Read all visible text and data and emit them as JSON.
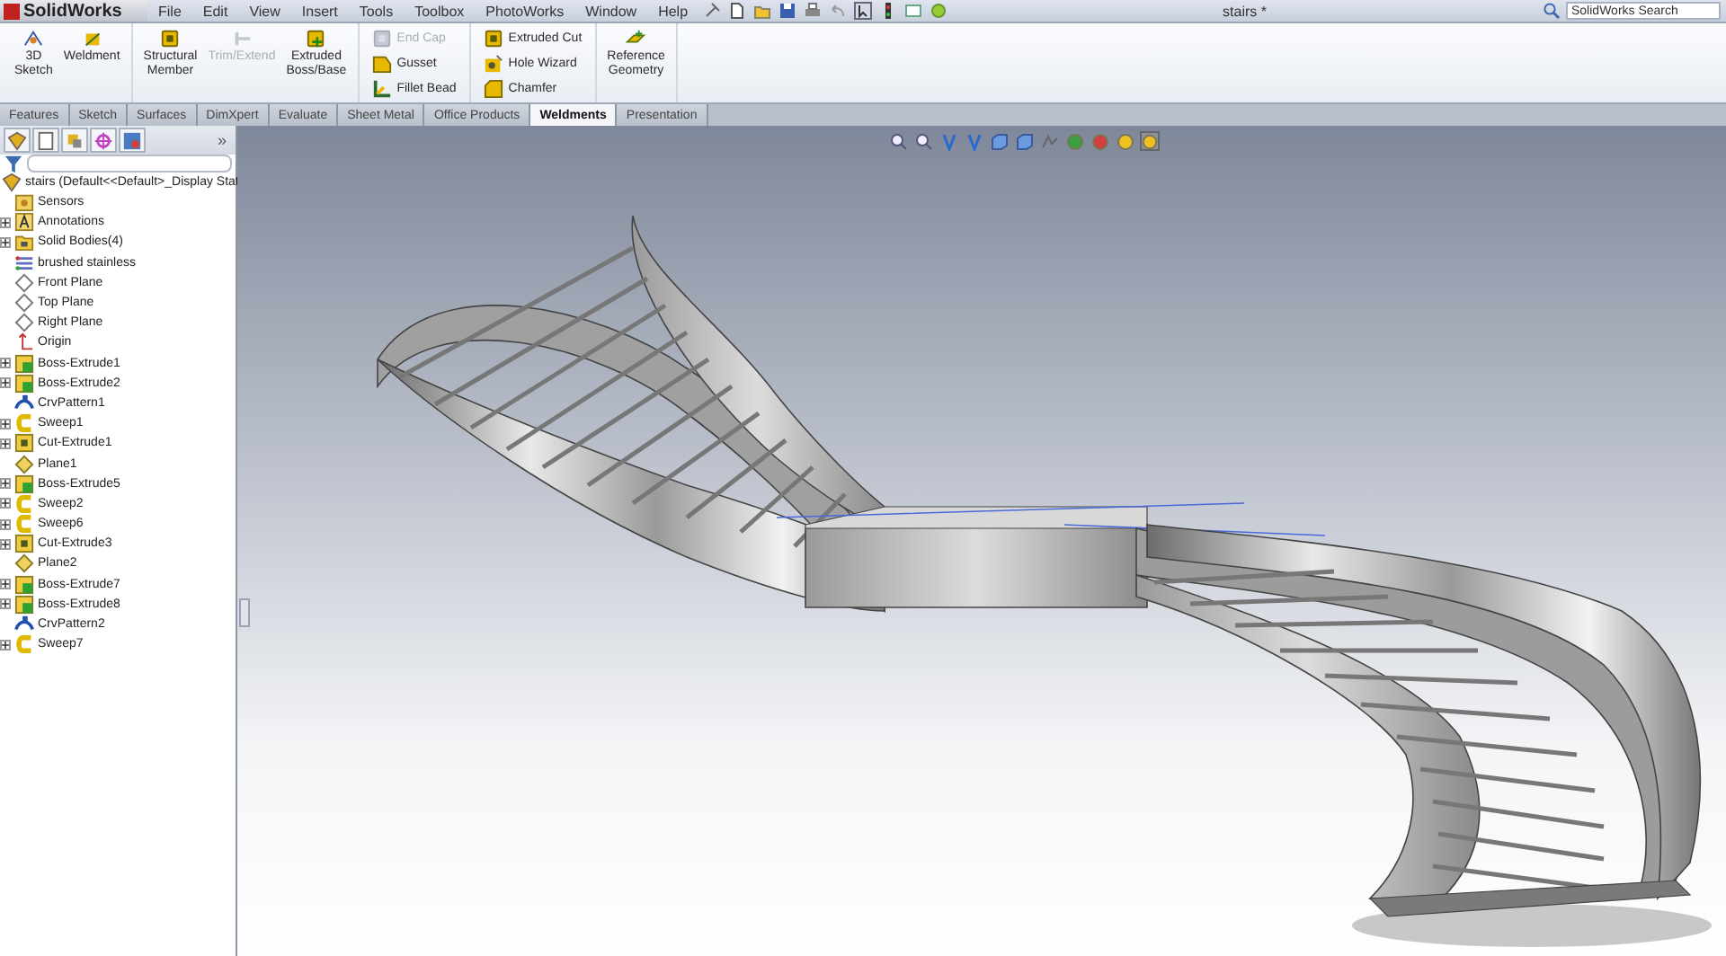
{
  "app": {
    "logo": "SolidWorks",
    "document_title": "stairs *",
    "search": {
      "placeholder": "SolidWorks Search"
    }
  },
  "menu": [
    "File",
    "Edit",
    "View",
    "Insert",
    "Tools",
    "Toolbox",
    "PhotoWorks",
    "Window",
    "Help"
  ],
  "ribbon": {
    "groups": [
      {
        "kind": "large",
        "items": [
          {
            "label": "3D Sketch",
            "kind": "sketch3d",
            "disabled": false
          },
          {
            "label": "Weldment",
            "kind": "weldment",
            "disabled": false
          }
        ]
      },
      {
        "kind": "large",
        "items": [
          {
            "label": "Structural Member",
            "kind": "member",
            "disabled": false
          },
          {
            "label": "Trim/Extend",
            "kind": "trim",
            "disabled": true
          },
          {
            "label": "Extruded Boss/Base",
            "kind": "boss",
            "disabled": false
          }
        ]
      },
      {
        "kind": "small",
        "items": [
          {
            "label": "End Cap",
            "kind": "endcap",
            "disabled": true
          },
          {
            "label": "Gusset",
            "kind": "gusset",
            "disabled": false
          },
          {
            "label": "Fillet Bead",
            "kind": "bead",
            "disabled": false
          }
        ]
      },
      {
        "kind": "small",
        "items": [
          {
            "label": "Extruded Cut",
            "kind": "cut",
            "disabled": false
          },
          {
            "label": "Hole Wizard",
            "kind": "hole",
            "disabled": false
          },
          {
            "label": "Chamfer",
            "kind": "chamfer",
            "disabled": false
          }
        ]
      },
      {
        "kind": "large",
        "items": [
          {
            "label": "Reference Geometry",
            "kind": "refgeom",
            "disabled": false
          }
        ]
      }
    ]
  },
  "tabs": [
    {
      "label": "Features",
      "selected": false
    },
    {
      "label": "Sketch",
      "selected": false
    },
    {
      "label": "Surfaces",
      "selected": false
    },
    {
      "label": "DimXpert",
      "selected": false
    },
    {
      "label": "Evaluate",
      "selected": false
    },
    {
      "label": "Sheet Metal",
      "selected": false
    },
    {
      "label": "Office Products",
      "selected": false
    },
    {
      "label": "Weldments",
      "selected": true
    },
    {
      "label": "Presentation",
      "selected": false
    }
  ],
  "panel": {
    "more": "»",
    "root": "stairs  (Default<<Default>_Display Stat",
    "tree": [
      {
        "label": "Sensors",
        "kind": "sensor",
        "expandable": false
      },
      {
        "label": "Annotations",
        "kind": "annotation",
        "expandable": true
      },
      {
        "label": "Solid Bodies(4)",
        "kind": "folder",
        "expandable": true
      },
      {
        "label": "brushed stainless",
        "kind": "material",
        "expandable": false
      },
      {
        "label": "Front Plane",
        "kind": "plane",
        "expandable": false
      },
      {
        "label": "Top Plane",
        "kind": "plane",
        "expandable": false
      },
      {
        "label": "Right Plane",
        "kind": "plane",
        "expandable": false
      },
      {
        "label": "Origin",
        "kind": "origin",
        "expandable": false
      },
      {
        "label": "Boss-Extrude1",
        "kind": "extrude",
        "expandable": true
      },
      {
        "label": "Boss-Extrude2",
        "kind": "extrude",
        "expandable": true
      },
      {
        "label": "CrvPattern1",
        "kind": "pattern",
        "expandable": false
      },
      {
        "label": "Sweep1",
        "kind": "sweep",
        "expandable": true
      },
      {
        "label": "Cut-Extrude1",
        "kind": "cut",
        "expandable": true
      },
      {
        "label": "Plane1",
        "kind": "refplane",
        "expandable": false
      },
      {
        "label": "Boss-Extrude5",
        "kind": "extrude",
        "expandable": true
      },
      {
        "label": "Sweep2",
        "kind": "sweep",
        "expandable": true
      },
      {
        "label": "Sweep6",
        "kind": "sweep",
        "expandable": true
      },
      {
        "label": "Cut-Extrude3",
        "kind": "cut",
        "expandable": true
      },
      {
        "label": "Plane2",
        "kind": "refplane",
        "expandable": false
      },
      {
        "label": "Boss-Extrude7",
        "kind": "extrude",
        "expandable": true
      },
      {
        "label": "Boss-Extrude8",
        "kind": "extrude",
        "expandable": true
      },
      {
        "label": "CrvPattern2",
        "kind": "pattern",
        "expandable": false
      },
      {
        "label": "Sweep7",
        "kind": "sweep",
        "expandable": true
      }
    ]
  }
}
